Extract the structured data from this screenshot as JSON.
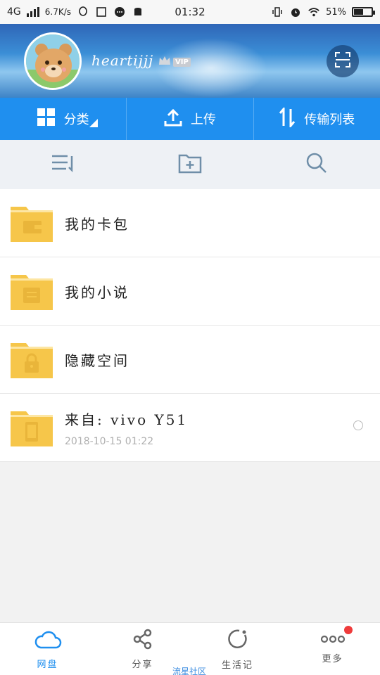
{
  "status_bar": {
    "network": "4G",
    "speed": "6.7K/s",
    "time": "01:32",
    "battery": "51%"
  },
  "header": {
    "username": "heartijjj",
    "vip_label": "VIP"
  },
  "actions": [
    {
      "label": "分类",
      "icon": "grid-icon"
    },
    {
      "label": "上传",
      "icon": "upload-icon"
    },
    {
      "label": "传输列表",
      "icon": "transfer-icon"
    }
  ],
  "toolbar": {
    "icons": [
      "sort-icon",
      "new-folder-icon",
      "search-icon"
    ]
  },
  "files": [
    {
      "name": "我的卡包",
      "icon": "wallet-folder-icon"
    },
    {
      "name": "我的小说",
      "icon": "book-folder-icon"
    },
    {
      "name": "隐藏空间",
      "icon": "lock-folder-icon"
    },
    {
      "name": "来自: vivo Y51",
      "date": "2018-10-15  01:22",
      "icon": "phone-folder-icon"
    }
  ],
  "bottom_nav": [
    {
      "label": "网盘",
      "icon": "cloud-icon",
      "active": true
    },
    {
      "label": "分享",
      "icon": "share-icon"
    },
    {
      "label": "生活记",
      "icon": "refresh-circle-icon"
    },
    {
      "label": "更多",
      "icon": "more-icon"
    }
  ],
  "watermark": "流星社区",
  "colors": {
    "accent": "#1f8fef",
    "folder": "#f6c64a",
    "badge": "#ef3b3b"
  }
}
